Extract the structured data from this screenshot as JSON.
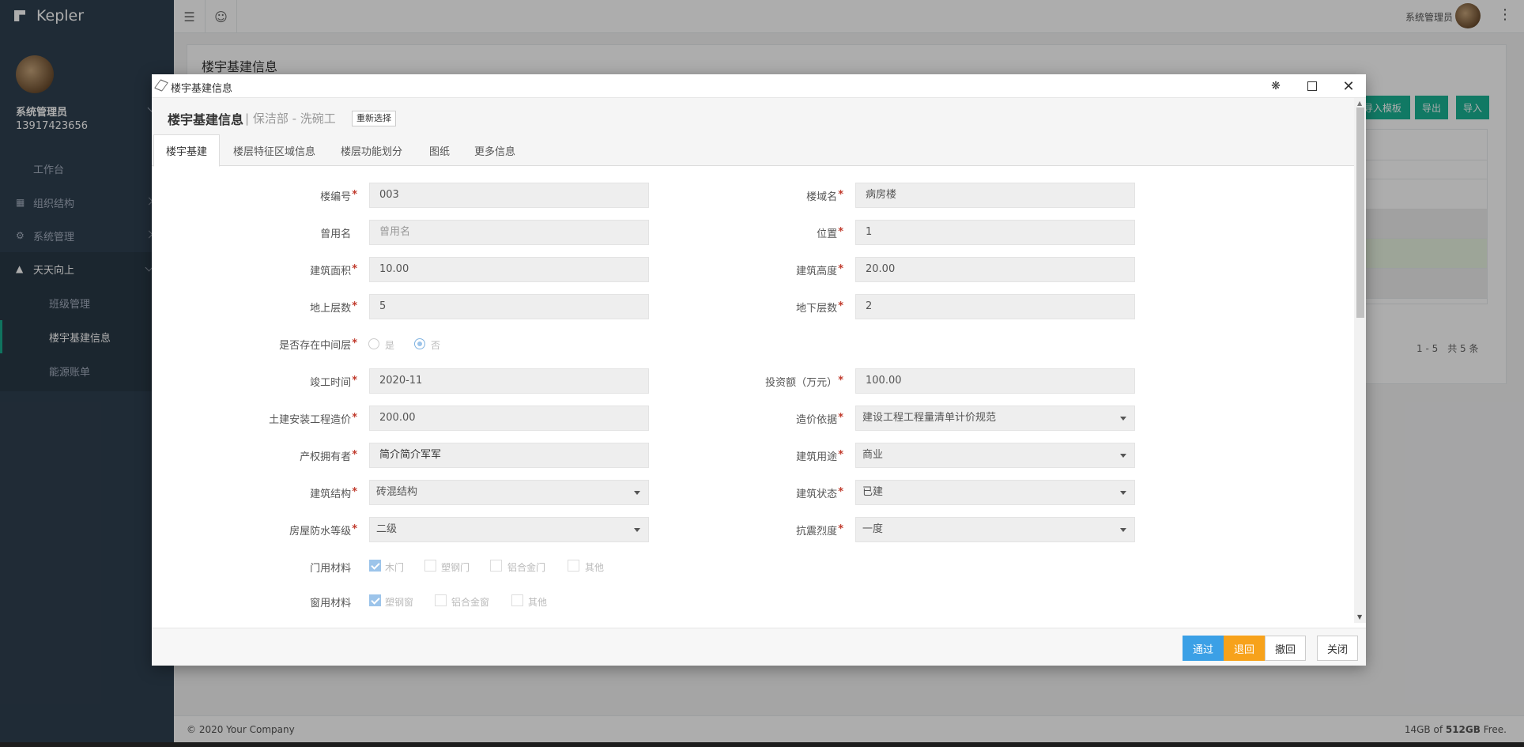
{
  "app": {
    "brand": "Kepler"
  },
  "sidebar": {
    "user_name": "系统管理员",
    "user_phone": "13917423656",
    "items": [
      {
        "label": "工作台"
      },
      {
        "label": "组织结构",
        "icon": "users-icon"
      },
      {
        "label": "系统管理",
        "icon": "gears-icon"
      },
      {
        "label": "天天向上",
        "icon": "graduation-cap-icon"
      }
    ],
    "sub_items": [
      {
        "label": "班级管理"
      },
      {
        "label": "楼宇基建信息"
      },
      {
        "label": "能源账单"
      }
    ]
  },
  "topbar": {
    "user_label": "系统管理员"
  },
  "background": {
    "page_title": "楼宇基建信息",
    "buttons": [
      "导入模板",
      "导出",
      "导入"
    ],
    "pager": "1 - 5　共 5 条",
    "footer_left": "© 2020 Your Company",
    "footer_right_pre": "14GB of ",
    "footer_right_bold": "512GB",
    "footer_right_post": " Free."
  },
  "modal": {
    "title": "楼宇基建信息",
    "info_title": "楼宇基建信息",
    "info_sub": "| 保洁部 - 洗碗工",
    "reselect": "重新选择",
    "tabs": [
      "楼宇基建",
      "楼层特征区域信息",
      "楼层功能划分",
      "图纸",
      "更多信息"
    ],
    "form": {
      "building_no": {
        "label": "楼编号",
        "value": "003"
      },
      "building_name": {
        "label": "楼域名",
        "value": "病房楼"
      },
      "former_name": {
        "label": "曾用名",
        "placeholder": "曾用名"
      },
      "location": {
        "label": "位置",
        "value": "1"
      },
      "floor_area": {
        "label": "建筑面积",
        "value": "10.00"
      },
      "height": {
        "label": "建筑高度",
        "value": "20.00"
      },
      "floors_above": {
        "label": "地上层数",
        "value": "5"
      },
      "floors_below": {
        "label": "地下层数",
        "value": "2"
      },
      "mezzanine": {
        "label": "是否存在中间层",
        "opt_yes": "是",
        "opt_no": "否",
        "selected": "否"
      },
      "completion": {
        "label": "竣工时间",
        "value": "2020-11"
      },
      "investment": {
        "label": "投资额（万元）",
        "value": "100.00"
      },
      "civil_cost": {
        "label": "土建安装工程造价",
        "value": "200.00"
      },
      "pricing_basis": {
        "label": "造价依据",
        "value": "建设工程工程量清单计价规范"
      },
      "owner": {
        "label": "产权拥有者",
        "value": "简介简介军军"
      },
      "usage": {
        "label": "建筑用途",
        "value": "商业"
      },
      "structure": {
        "label": "建筑结构",
        "value": "砖混结构"
      },
      "status": {
        "label": "建筑状态",
        "value": "已建"
      },
      "waterproof": {
        "label": "房屋防水等级",
        "value": "二级"
      },
      "seismic": {
        "label": "抗震烈度",
        "value": "一度"
      },
      "door_material": {
        "label": "门用材料",
        "options": [
          "木门",
          "塑钢门",
          "铝合金门",
          "其他"
        ],
        "checked": [
          true,
          false,
          false,
          false
        ]
      },
      "window_material": {
        "label": "窗用材料",
        "options": [
          "塑钢窗",
          "铝合金窗",
          "其他"
        ],
        "checked": [
          true,
          false,
          false
        ]
      }
    },
    "footer": {
      "approve": "通过",
      "reject": "退回",
      "revoke": "撤回",
      "close": "关闭"
    }
  },
  "colors": {
    "sidebar": "#2f4050",
    "accent": "#1ab394",
    "approve": "#3ba0e6",
    "reject": "#f7a21b"
  }
}
